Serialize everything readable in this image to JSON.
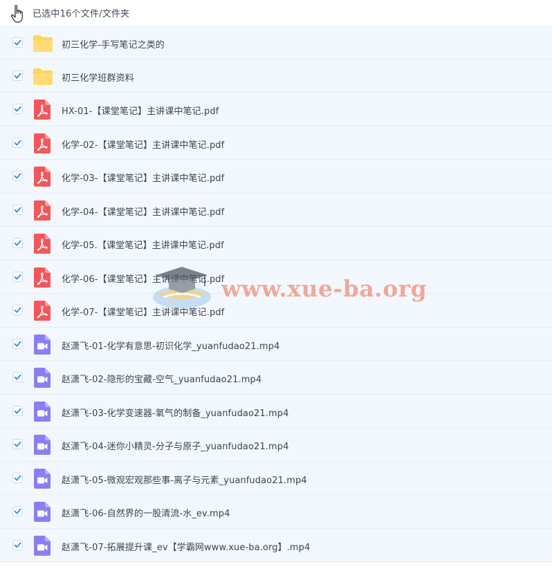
{
  "header": {
    "selection_text": "已选中16个文件/文件夹"
  },
  "colors": {
    "row_bg": "#f3f8fe",
    "check": "#3b8cf2",
    "folder": "#ffd45c",
    "pdf": "#f2575b",
    "video": "#8c7ef2"
  },
  "files": [
    {
      "name": "初三化学-手写笔记之类的",
      "type": "folder"
    },
    {
      "name": "初三化学班群资料",
      "type": "folder"
    },
    {
      "name": "HX-01-【课堂笔记】主讲课中笔记.pdf",
      "type": "pdf"
    },
    {
      "name": "化学-02-【课堂笔记】主讲课中笔记.pdf",
      "type": "pdf"
    },
    {
      "name": "化学-03-【课堂笔记】主讲课中笔记.pdf",
      "type": "pdf"
    },
    {
      "name": "化学-04-【课堂笔记】主讲课中笔记.pdf",
      "type": "pdf"
    },
    {
      "name": "化学-05.【课堂笔记】主讲课中笔记.pdf",
      "type": "pdf"
    },
    {
      "name": "化学-06-【课堂笔记】主讲课中笔记.pdf",
      "type": "pdf"
    },
    {
      "name": "化学-07-【课堂笔记】主讲课中笔记.pdf",
      "type": "pdf"
    },
    {
      "name": "赵潇飞-01-化学有意思-初识化学_yuanfudao21.mp4",
      "type": "video"
    },
    {
      "name": "赵潇飞-02-隐形的宝藏-空气_yuanfudao21.mp4",
      "type": "video"
    },
    {
      "name": "赵潇飞-03-化学变速器-氧气的制备_yuanfudao21.mp4",
      "type": "video"
    },
    {
      "name": "赵潇飞-04-迷你小精灵-分子与原子_yuanfudao21.mp4",
      "type": "video"
    },
    {
      "name": "赵潇飞-05-微观宏观那些事-离子与元素_yuanfudao21.mp4",
      "type": "video"
    },
    {
      "name": "赵潇飞-06-自然界的一股清流-水_ev.mp4",
      "type": "video"
    },
    {
      "name": "赵潇飞-07-拓展提升课_ev【学霸网www.xue-ba.org】.mp4",
      "type": "video"
    }
  ],
  "watermark": {
    "text": "www.xue-ba.org"
  }
}
